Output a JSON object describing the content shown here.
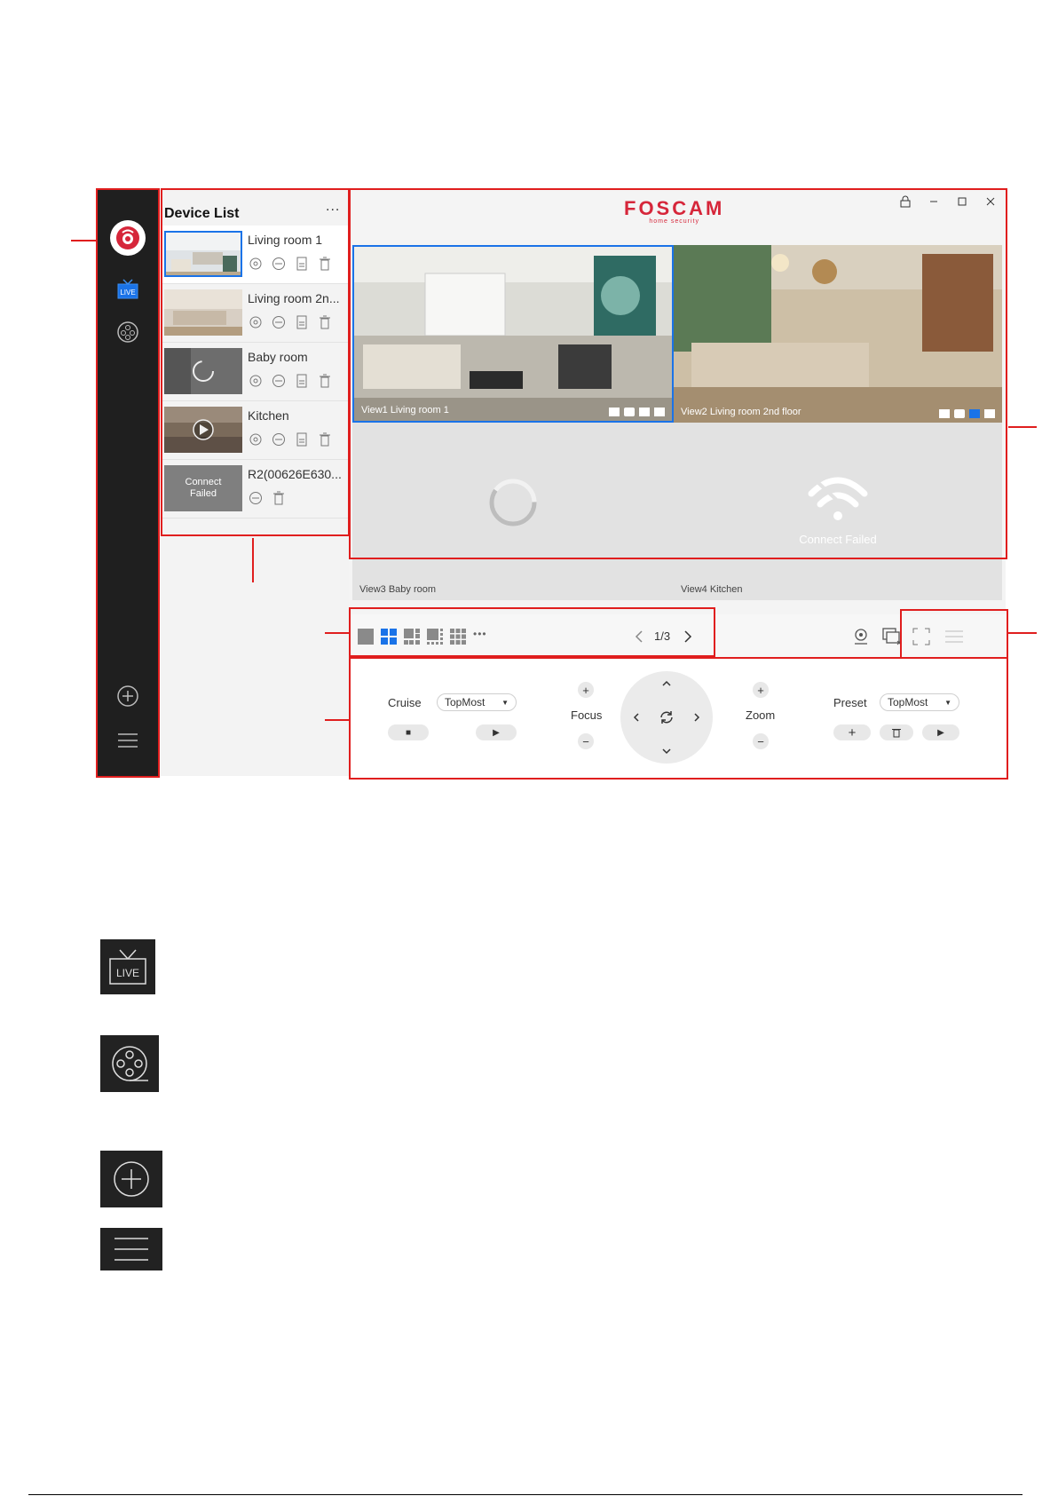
{
  "app": {
    "brand": "FOSCAM",
    "brand_sub": "home security"
  },
  "device_list": {
    "title": "Device List",
    "more": "...",
    "items": [
      {
        "name": "Living room 1"
      },
      {
        "name": "Living room 2n..."
      },
      {
        "name": "Baby room"
      },
      {
        "name": "Kitchen"
      },
      {
        "name": "R2(00626E630...",
        "thumb_text": "Connect Failed"
      }
    ]
  },
  "views": [
    {
      "label": "View1 Living room 1"
    },
    {
      "label": "View2 Living room 2nd floor"
    },
    {
      "label": "View3 Baby room"
    },
    {
      "label": "View4 Kitchen",
      "status": "Connect Failed"
    }
  ],
  "toolbar": {
    "more": "•••",
    "page": "1/3"
  },
  "ptz": {
    "cruise_label": "Cruise",
    "cruise_value": "TopMost",
    "focus_label": "Focus",
    "zoom_label": "Zoom",
    "preset_label": "Preset",
    "preset_value": "TopMost"
  },
  "colors": {
    "accent": "#1a73e8",
    "brand": "#d6263a",
    "annotation": "#e01e1e",
    "sidebar": "#1f1f1f"
  }
}
